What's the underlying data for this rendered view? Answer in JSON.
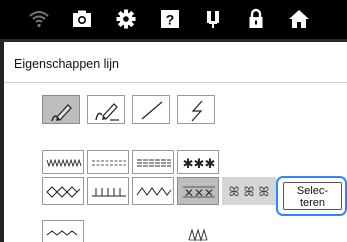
{
  "status_bar": {
    "icons": [
      "wifi-icon",
      "camera-icon",
      "settings-gear-icon",
      "help-icon",
      "needle-mode-icon",
      "lock-icon",
      "home-icon"
    ]
  },
  "panel": {
    "title": "Eigenschappen lijn"
  },
  "line_tools": {
    "items": [
      "pencil-select-icon",
      "pencil-draw-icon",
      "straight-line-icon",
      "zigzag-line-icon"
    ],
    "selected_index": 0
  },
  "stitch_types": {
    "row1": [
      "zigzag-stitch",
      "running-stitch-dashed",
      "triple-stitch-dashed",
      "star-stitch"
    ],
    "row2": [
      "diamond-stitch",
      "blanket-stitch",
      "wave-stitch",
      "decorative-x-stitch",
      "decorative-x-stitch-preview"
    ],
    "row3": [
      "scallop-stitch",
      "decorative-candle-stitch"
    ],
    "selected": "decorative-x-stitch"
  },
  "select_button": {
    "label_line1": "Selec-",
    "label_line2": "teren"
  },
  "colors": {
    "accent": "#2f86ff",
    "selected_bg": "#bdbdbd",
    "bar": "#000000"
  }
}
